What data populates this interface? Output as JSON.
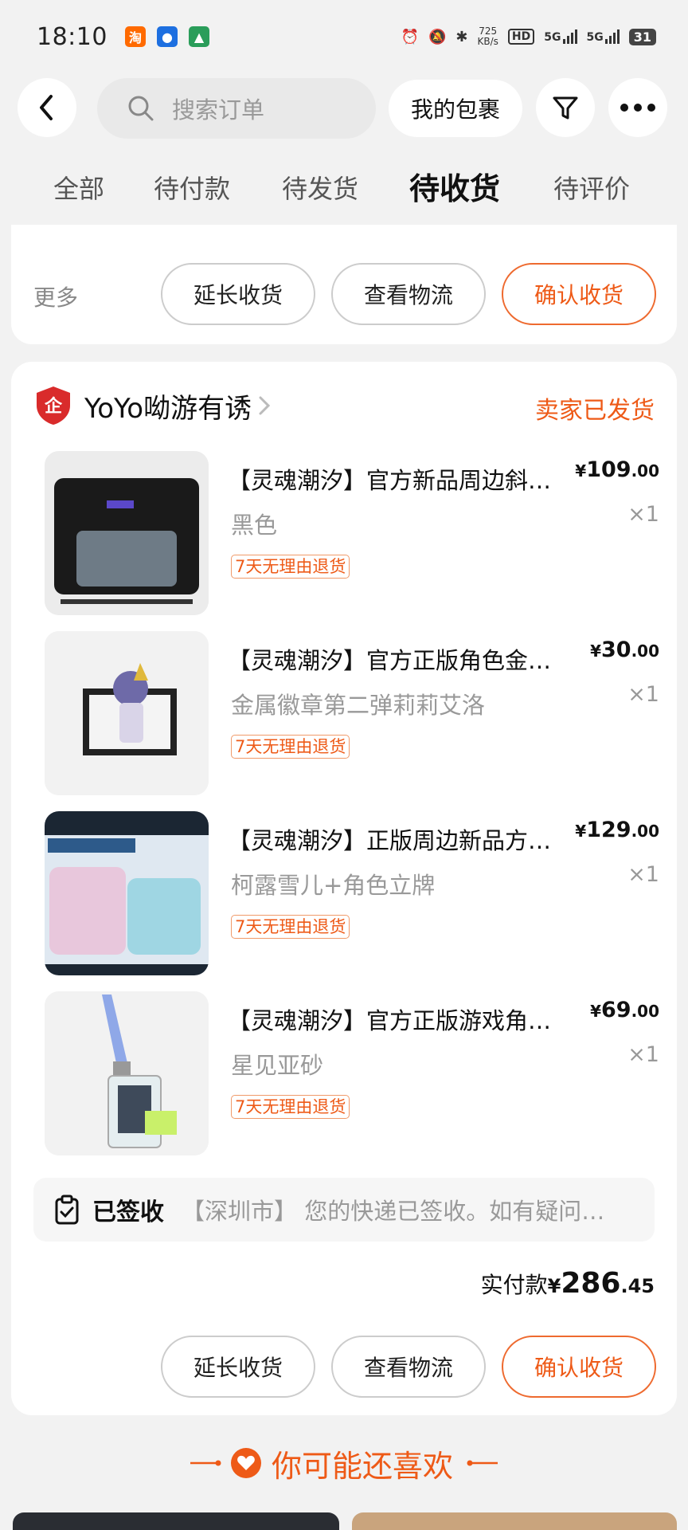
{
  "status_bar": {
    "time": "18:10",
    "net_speed_value": "725",
    "net_speed_unit": "KB/s",
    "hd": "HD",
    "sig1": "5G",
    "sig2": "5G",
    "battery": "31",
    "apps": [
      {
        "label": "淘",
        "color": "#ff6a00"
      },
      {
        "label": "●",
        "color": "#1d6fe0"
      },
      {
        "label": "▲",
        "color": "#2a9d5a"
      }
    ]
  },
  "header": {
    "search_placeholder": "搜索订单",
    "my_packages": "我的包裹",
    "icons": [
      "back-icon",
      "search-icon",
      "filter-icon",
      "more-icon"
    ]
  },
  "tabs": [
    "全部",
    "待付款",
    "待发货",
    "待收货",
    "待评价"
  ],
  "active_tab": "待收货",
  "top_card": {
    "more": "更多",
    "buttons": [
      "延长收货",
      "查看物流",
      "确认收货"
    ]
  },
  "order": {
    "shop_name": "YoYo呦游有诱",
    "shop_logo_char": "企",
    "status": "卖家已发货",
    "items": [
      {
        "title": "【灵魂潮汐】官方新品周边斜挎包痛包",
        "sku": "黑色",
        "badge": "7天无理由退货",
        "price_int": "109",
        "price_dec": ".00",
        "qty": "×1"
      },
      {
        "title": "【灵魂潮汐】官方正版角色金属徽章",
        "sku": "金属徽章第二弹莉莉艾洛",
        "badge": "7天无理由退货",
        "price_int": "30",
        "price_dec": ".00",
        "qty": "×1"
      },
      {
        "title": "【灵魂潮汐】正版周边新品方形抱枕",
        "sku": "柯露雪儿+角色立牌",
        "badge": "7天无理由退货",
        "price_int": "129",
        "price_dec": ".00",
        "qty": "×1"
      },
      {
        "title": "【灵魂潮汐】官方正版游戏角色挂件",
        "sku": "星见亚砂",
        "badge": "7天无理由退货",
        "price_int": "69",
        "price_dec": ".00",
        "qty": "×1"
      }
    ],
    "currency": "¥",
    "logistics_status": "已签收",
    "logistics_detail": "【深圳市】 您的快递已签收。如有疑问请联系快递员",
    "total_label": "实付款",
    "total_int": "286",
    "total_dec": ".45",
    "buttons": [
      "延长收货",
      "查看物流",
      "确认收货"
    ]
  },
  "recommend": {
    "title": "你可能还喜欢"
  },
  "colors": {
    "accent": "#ee5a17",
    "background": "#f2f2f2",
    "card": "#ffffff"
  }
}
